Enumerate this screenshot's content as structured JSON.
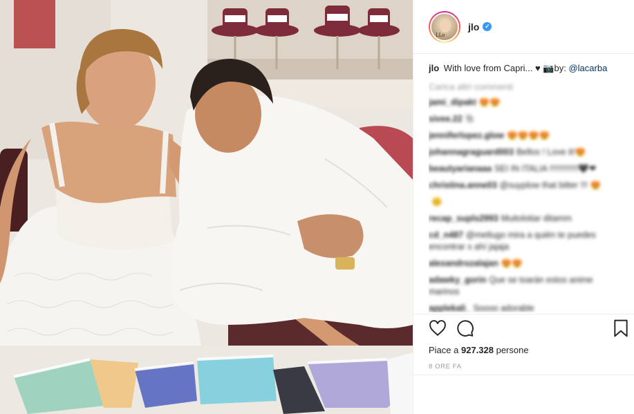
{
  "post": {
    "username": "jlo",
    "verified_icon": "verified-badge-icon",
    "avatar_label": "J.Lo",
    "caption": {
      "username": "jlo",
      "text": "With love from Capri... ♥ 📷by: ",
      "mention": "@lacarba"
    },
    "load_more": "Carica altri commenti",
    "comments": [
      {
        "user": "jami_dipakt",
        "text": "😍😍"
      },
      {
        "user": "sivee.22",
        "text": "🐘"
      },
      {
        "user": "jenniferlopez.glow",
        "text": "😍😍😍😍"
      },
      {
        "user": "johannagraguard003",
        "text": "Bellos ! Love it!😍"
      },
      {
        "user": "beautyarianaaa",
        "text": "SEI IN ITALIA !!!!!!!!!!!!🖤❤"
      },
      {
        "user": "christina.anne03",
        "text": "@suyplow that bitter !!! 😍"
      },
      {
        "user": "",
        "text": "😊"
      },
      {
        "user": "recap_supls2993",
        "text": "Muitolotiar ditamm"
      },
      {
        "user": "cd_n487",
        "text": "@metlugo mira a quién te puedes encontrar x ahí jajaja"
      },
      {
        "user": "alexandrozalajan",
        "text": "😍😍"
      },
      {
        "user": "adawky_gorin",
        "text": "Que se toarán estos anime marinos"
      },
      {
        "user": "applekali_",
        "text": "Soooo adorable"
      }
    ],
    "actions": {
      "like_icon": "heart-icon",
      "comment_icon": "comment-bubble-icon",
      "save_icon": "bookmark-icon"
    },
    "likes_prefix": "Piace a ",
    "likes_count": "927.328",
    "likes_suffix": " persone",
    "time_ago": "8 ORE FA"
  },
  "colors": {
    "accent_blue": "#3897f0",
    "mention": "#003569",
    "muted": "#999999",
    "border": "#efefef"
  }
}
